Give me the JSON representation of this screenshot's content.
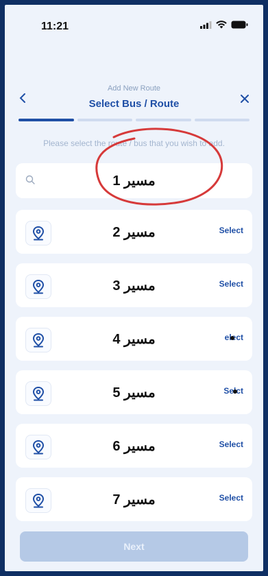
{
  "status": {
    "time": "11:21"
  },
  "header": {
    "subtitle": "Add New Route",
    "title": "Select Bus / Route",
    "back_icon": "chevron-left-icon",
    "close_icon": "close-icon"
  },
  "progress": {
    "steps": 4,
    "active": 1
  },
  "hint": "Please select the route / bus that you wish to add.",
  "search": {
    "route_label": "مسير 1"
  },
  "routes": [
    {
      "label": "مسير 2",
      "action": "Select"
    },
    {
      "label": "مسير 3",
      "action": "Select"
    },
    {
      "label": "مسير 4",
      "action": "elect"
    },
    {
      "label": "مسير 5",
      "action": "Selct"
    },
    {
      "label": "مسير 6",
      "action": "Select"
    },
    {
      "label": "مسير 7",
      "action": "Select"
    }
  ],
  "footer": {
    "next_label": "Next"
  },
  "colors": {
    "primary": "#1f4fa6",
    "background": "#eef3fb",
    "frame": "#0f2f63",
    "annotation": "#d63a3a"
  }
}
